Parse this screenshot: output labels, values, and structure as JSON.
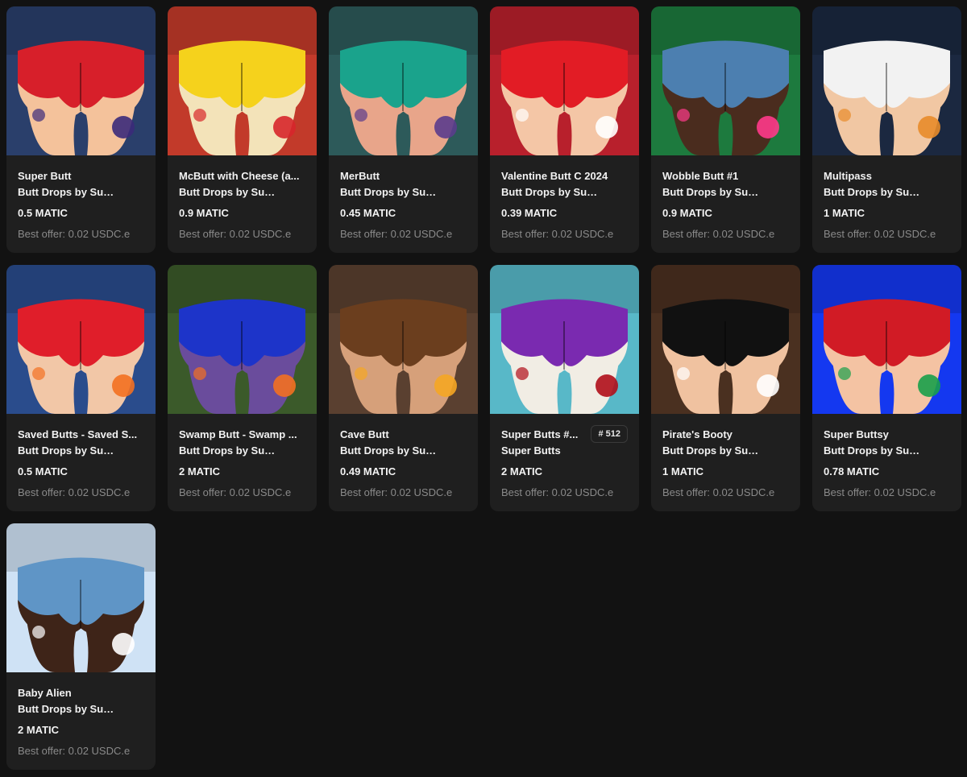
{
  "items": [
    {
      "title": "Super Butt",
      "collection": "Butt Drops by Sup...",
      "price": "0.5 MATIC",
      "offer": "Best offer: 0.02 USDC.e",
      "bg": "#2a3f6b",
      "skin": "#f4c29b",
      "cloth": "#d71f2a",
      "accent": "#3b2a7a",
      "icon": "starfish-icon"
    },
    {
      "title": "McButt with Cheese (a...",
      "collection": "Butt Drops by Sup...",
      "price": "0.9 MATIC",
      "offer": "Best offer: 0.02 USDC.e",
      "bg": "#c23a2a",
      "skin": "#f3e3b9",
      "cloth": "#f5d21c",
      "accent": "#d7262b",
      "icon": "mcdonalds-logo-icon"
    },
    {
      "title": "MerButt",
      "collection": "Butt Drops by Sup...",
      "price": "0.45 MATIC",
      "offer": "Best offer: 0.02 USDC.e",
      "bg": "#2d5a5a",
      "skin": "#e8a58a",
      "cloth": "#1aa38c",
      "accent": "#5b3c8c",
      "icon": "scales-icon"
    },
    {
      "title": "Valentine Butt C 2024",
      "collection": "Butt Drops by Sup...",
      "price": "0.39 MATIC",
      "offer": "Best offer: 0.02 USDC.e",
      "bg": "#b8202c",
      "skin": "#f4c6a6",
      "cloth": "#e21c25",
      "accent": "#ffffff",
      "icon": "heart-icon"
    },
    {
      "title": "Wobble Butt #1",
      "collection": "Butt Drops by Sup...",
      "price": "0.9 MATIC",
      "offer": "Best offer: 0.02 USDC.e",
      "bg": "#1d7a3e",
      "skin": "#4a2c1e",
      "cloth": "#4c7fb0",
      "accent": "#ff3a8a",
      "icon": "teddy-bear-icon"
    },
    {
      "title": "Multipass",
      "collection": "Butt Drops by Sup...",
      "price": "1 MATIC",
      "offer": "Best offer: 0.02 USDC.e",
      "bg": "#1b2840",
      "skin": "#f1c7a3",
      "cloth": "#f2f2f2",
      "accent": "#e88b2a",
      "icon": "id-card-icon"
    },
    {
      "title": "Saved Butts - Saved S...",
      "collection": "Butt Drops by Sup...",
      "price": "0.5 MATIC",
      "offer": "Best offer: 0.02 USDC.e",
      "bg": "#2a4c8c",
      "skin": "#f2c7a7",
      "cloth": "#e01e2a",
      "accent": "#f37021",
      "icon": "lifebuoy-icon"
    },
    {
      "title": "Swamp Butt - Swamp ...",
      "collection": "Butt Drops by Sup...",
      "price": "2 MATIC",
      "offer": "Best offer: 0.02 USDC.e",
      "bg": "#3b5a2a",
      "skin": "#6a4c9c",
      "cloth": "#1d34c9",
      "accent": "#f37021",
      "icon": "lifebuoy-icon"
    },
    {
      "title": "Cave Butt",
      "collection": "Butt Drops by Sup...",
      "price": "0.49 MATIC",
      "offer": "Best offer: 0.02 USDC.e",
      "bg": "#5a4030",
      "skin": "#d6a07a",
      "cloth": "#6b3e1e",
      "accent": "#f5a623",
      "icon": "handprint-icon"
    },
    {
      "title": "Super Butts #...",
      "collection": "Super Butts",
      "price": "2 MATIC",
      "offer": "Best offer: 0.02 USDC.e",
      "badge": "# 512",
      "bg": "#58b8c8",
      "skin": "#f1ede4",
      "cloth": "#7a2ab0",
      "accent": "#b00e1a",
      "icon": "blood-drop-icon"
    },
    {
      "title": "Pirate's Booty",
      "collection": "Butt Drops by Sup...",
      "price": "1 MATIC",
      "offer": "Best offer: 0.02 USDC.e",
      "bg": "#4a3020",
      "skin": "#f0c2a0",
      "cloth": "#111111",
      "accent": "#ffffff",
      "icon": "skull-crossbones-icon"
    },
    {
      "title": "Super Buttsy",
      "collection": "Butt Drops by Sup...",
      "price": "0.78 MATIC",
      "offer": "Best offer: 0.02 USDC.e",
      "bg": "#1438f0",
      "skin": "#f4c3a3",
      "cloth": "#d11b25",
      "accent": "#1aa04a",
      "icon": "money-icon"
    },
    {
      "title": "Baby Alien",
      "collection": "Butt Drops by Sup...",
      "price": "2 MATIC",
      "offer": "Best offer: 0.02 USDC.e",
      "bg": "#cfe2f5",
      "skin": "#3e2418",
      "cloth": "#5f95c6",
      "accent": "#ffffff",
      "icon": "alien-baby-icon"
    }
  ]
}
